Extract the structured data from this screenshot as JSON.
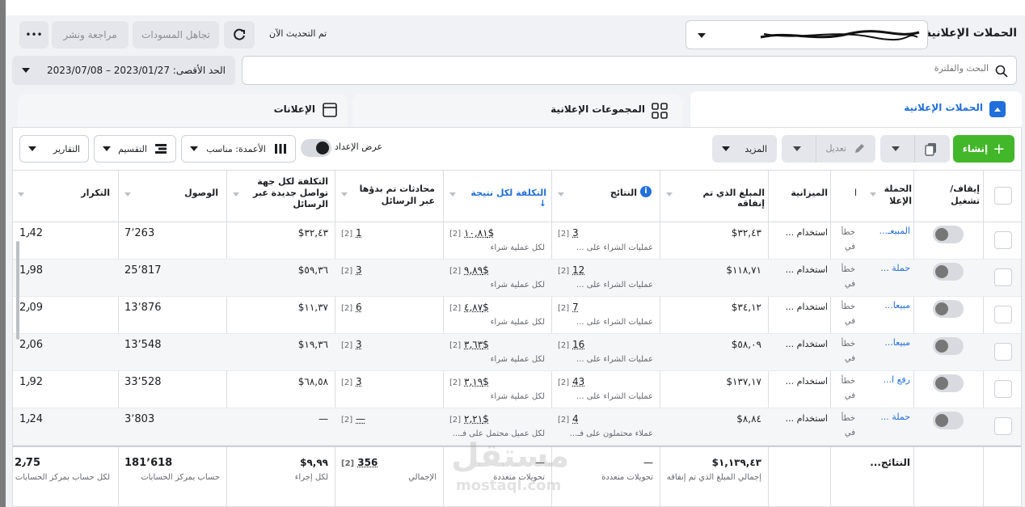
{
  "header": {
    "title": "الحملات الإعلانية",
    "account_value": "",
    "updated_text": "تم التحديث الآن",
    "discard_drafts_label": "تجاهل المسودات",
    "review_publish_label": "مراجعة ونشر",
    "more_label": "•••"
  },
  "search": {
    "placeholder": "البحث والفلترة",
    "date_label": "الحد الأقصى: 2023/01/27 – 2023/07/08"
  },
  "tabs": [
    {
      "label": "الحملات الإعلانية"
    },
    {
      "label": "المجموعات الإعلانية"
    },
    {
      "label": "الإعلانات"
    }
  ],
  "toolbar": {
    "create_label": "إنشاء",
    "edit_label": "تعديل",
    "more_label": "المزيد",
    "setup_label": "عرض الإعداد",
    "columns_label": "الأعمدة: مناسب",
    "breakdown_label": "التقسيم",
    "reports_label": "التقارير"
  },
  "table": {
    "headers": {
      "onoff": "إيقاف/ تشغيل",
      "campaign": "الحملة الإعلا",
      "delivery": "ا",
      "budget": "الميزانية",
      "spent": "المبلغ الذي تم إنفاقه",
      "results": "النتائج",
      "cost_per_result": "التكلفة لكل نتيجة ↓",
      "conversations": "محادثات تم بدؤها عبر الرسائل",
      "cost_per_contact": "التكلفة لكل جهة تواصل جديدة عبر الرسائل",
      "reach": "الوصول",
      "frequency": "التكرار"
    },
    "rows": [
      {
        "name": "المبيعـ...",
        "delivery": "خطأ في",
        "budget": "استخدام ...",
        "spent": "٣٢,٤٣$",
        "results": "3",
        "results_sub": "عمليات الشراء على ...",
        "cpr": "١٠,٨١$",
        "cpr_sub": "لكل عملية شراء",
        "conv": "1",
        "cpc": "٣٢,٤٣$",
        "reach": "7٬263",
        "freq": "1٫42"
      },
      {
        "name": "حملة ...",
        "delivery": "خطأ في",
        "budget": "استخدام ...",
        "spent": "١١٨,٧١$",
        "results": "12",
        "results_sub": "عمليات الشراء على ...",
        "cpr": "٩,٨٩$",
        "cpr_sub": "لكل عملية شراء",
        "conv": "3",
        "cpc": "٥٩,٣٦$",
        "reach": "25٬817",
        "freq": "1٫98"
      },
      {
        "name": "مبيعا...",
        "delivery": "خطأ في",
        "budget": "استخدام ...",
        "spent": "٣٤,١٢$",
        "results": "7",
        "results_sub": "عمليات الشراء على ...",
        "cpr": "٤,٨٧$",
        "cpr_sub": "لكل عملية شراء",
        "conv": "6",
        "cpc": "١١,٣٧$",
        "reach": "13٬876",
        "freq": "2٫09"
      },
      {
        "name": "مبيعا...",
        "delivery": "خطأ في",
        "budget": "استخدام ...",
        "spent": "٥٨,٠٩$",
        "results": "16",
        "results_sub": "عمليات الشراء على ...",
        "cpr": "٣,٦٣$",
        "cpr_sub": "لكل عملية شراء",
        "conv": "3",
        "cpc": "١٩,٣٦$",
        "reach": "13٬548",
        "freq": "2٫06"
      },
      {
        "name": "رفع ا...",
        "delivery": "خطأ في",
        "budget": "استخدام ...",
        "spent": "١٣٧,١٧$",
        "results": "43",
        "results_sub": "عمليات الشراء على ...",
        "cpr": "٣,١٩$",
        "cpr_sub": "لكل عملية شراء",
        "conv": "3",
        "cpc": "٦٨,٥٨$",
        "reach": "33٬528",
        "freq": "1٫92"
      },
      {
        "name": "حملة ...",
        "delivery": "خطأ في",
        "budget": "استخدام ...",
        "spent": "٨,٨٤$",
        "results": "4",
        "results_sub": "عملاء محتملون على فـ...",
        "cpr": "٢,٢١$",
        "cpr_sub": "لكل عميل محتمل على فـ...",
        "conv": "—",
        "cpc": "—",
        "reach": "3٬803",
        "freq": "1٫24"
      }
    ],
    "totals": {
      "label": "النتائج...",
      "spent": "١,١٣٩,٤٣$",
      "spent_sub": "إجمالي المبلغ الذي تم إنفاقه",
      "results": "—",
      "results_sub": "تحويلات متعددة",
      "cpr": "—",
      "cpr_sub": "تحويلات متعددة",
      "conv": "356",
      "conv_sub": "الإجمالي",
      "cpc": "٩,٩٩$",
      "cpc_sub": "لكل إجراء",
      "reach": "181٬618",
      "reach_sub": "حساب بمركز الحسابات",
      "freq": "2٫75",
      "freq_sub": "لكل حساب بمركز الحسابات"
    },
    "footnote_tag": "[2]"
  },
  "watermark": {
    "ar": "مستقل",
    "en": "mostaql.com"
  },
  "colors": {
    "accent": "#42b72a",
    "link": "#216fdb",
    "scroll": "#bcc0c4"
  }
}
